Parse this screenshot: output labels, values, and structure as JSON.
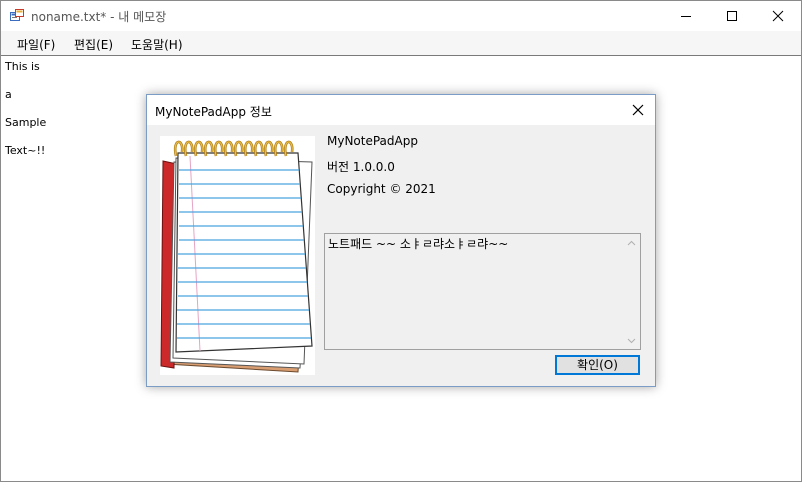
{
  "window": {
    "title": "noname.txt* - 내 메모장"
  },
  "caption_buttons": {
    "minimize_icon": "minimize-icon",
    "maximize_icon": "maximize-icon",
    "close_icon": "close-icon"
  },
  "menu": {
    "items": [
      {
        "label": "파일(F)"
      },
      {
        "label": "편집(E)"
      },
      {
        "label": "도움말(H)"
      }
    ]
  },
  "editor": {
    "lines": [
      "This is",
      "a",
      "Sample",
      "Text~!!"
    ]
  },
  "about_dialog": {
    "title": "MyNotePadApp 정보",
    "product_name": "MyNotePadApp",
    "version": "버전 1.0.0.0",
    "copyright": "Copyright ©  2021",
    "description": "노트패드 ~~ 소ㅑㄹ랴소ㅑㄹ랴~~",
    "ok_label": "확인(O)"
  },
  "colors": {
    "accent": "#0078d7",
    "dialog_bg": "#f0f0f0",
    "notebook_cover": "#cc2a2a",
    "spiral": "#c8901c",
    "ruled_line": "#4aa3df"
  }
}
